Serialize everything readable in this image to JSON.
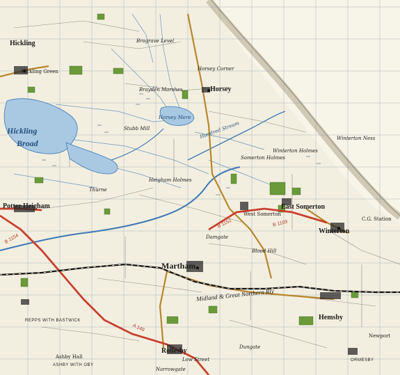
{
  "map": {
    "colors": {
      "paper": "#f3efe0",
      "grid": "#6e7e95",
      "water": "#3f78b4",
      "water_fill": "#a9c8e2",
      "road_primary": "#c8402f",
      "road_secondary": "#b8862e",
      "wood": "#6b9a3a",
      "marsh": "#3a5a7a",
      "coast": "#c9c3ae",
      "railway": "#111111"
    },
    "labels": {
      "hickling": "Hickling",
      "hickling_green": "Hickling Green",
      "hickling_broad_1": "Hickling",
      "hickling_broad_2": "Broad",
      "horsey": "Horsey",
      "horsey_corner": "Horsey Corner",
      "horsey_mere": "Horsey Mere",
      "brayden_marshes": "Brayden Marshes",
      "potter_heigham": "Potter Heigham",
      "martham": "Martham",
      "west_somerton": "West Somerton",
      "east_somerton": "East Somerton",
      "winterton": "Winterton",
      "winterton_ness": "Winterton Ness",
      "winterton_holmes": "Winterton Holmes",
      "somerton_holmes": "Somerton Holmes",
      "hemsby": "Hemsby",
      "rollesby": "Rollesby",
      "repps": "REPPS WITH BASTWICK",
      "ashby": "ASHBY WITH OBY",
      "ormesby": "ORMESBY",
      "newport": "Newport",
      "damgate": "Damgate",
      "dungate": "Dungate",
      "hundred_stream": "Hundred Stream",
      "heigham_holmes": "Heigham Holmes",
      "eel_fisher_stream": "Brograve Level",
      "railway": "Midland & Great Northern Rly",
      "bloodhill": "Blood Hill",
      "cg_station": "C.G. Station",
      "thurne": "Thurne",
      "narrowgate": "Narrowgate",
      "stubb_mill": "Stubb Mill",
      "ashby_hall": "Ashby Hall",
      "low_street": "Low Street",
      "b1159": "B 1159",
      "b1152": "B 1152",
      "b1154": "B 1154",
      "a149": "A 149"
    }
  }
}
